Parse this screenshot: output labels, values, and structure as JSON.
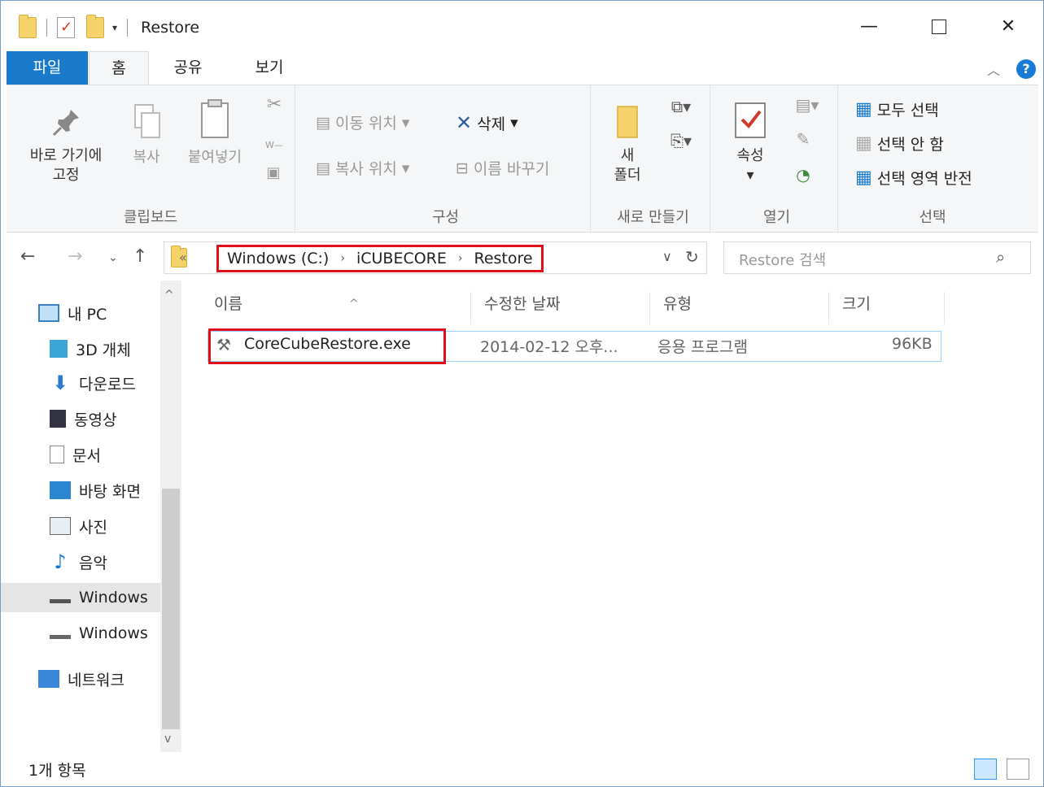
{
  "window": {
    "title": "Restore",
    "controls": {
      "minimize": "—",
      "close": "✕"
    }
  },
  "ribbon_tabs": [
    "파일",
    "홈",
    "공유",
    "보기"
  ],
  "ribbon": {
    "clipboard": {
      "label": "클립보드",
      "pin": "바로 가기에 고정",
      "pin_line1": "바로 가기에",
      "pin_line2": "고정",
      "copy": "복사",
      "paste": "붙여넣기"
    },
    "organize": {
      "label": "구성",
      "move_to": "이동 위치",
      "copy_to": "복사 위치",
      "delete": "삭제",
      "rename": "이름 바꾸기"
    },
    "new": {
      "label": "새로 만들기",
      "new_folder_line1": "새",
      "new_folder_line2": "폴더"
    },
    "open": {
      "label": "열기",
      "properties": "속성"
    },
    "select": {
      "label": "선택",
      "select_all": "모두 선택",
      "select_none": "선택 안 함",
      "invert": "선택 영역 반전"
    }
  },
  "address": {
    "overflow": "«",
    "crumbs": [
      "Windows (C:)",
      "iCUBECORE",
      "Restore"
    ],
    "search_placeholder": "Restore 검색"
  },
  "nav_pane": [
    {
      "label": "내 PC",
      "icon": "monitor-icon"
    },
    {
      "label": "3D 개체",
      "icon": "cube-icon"
    },
    {
      "label": "다운로드",
      "icon": "download-arrow-icon"
    },
    {
      "label": "동영상",
      "icon": "film-icon"
    },
    {
      "label": "문서",
      "icon": "document-icon"
    },
    {
      "label": "바탕 화면",
      "icon": "desktop-icon"
    },
    {
      "label": "사진",
      "icon": "picture-icon"
    },
    {
      "label": "음악",
      "icon": "music-note-icon"
    },
    {
      "label": "Windows",
      "icon": "drive-icon"
    },
    {
      "label": "Windows",
      "icon": "drive-icon"
    },
    {
      "label": "네트워크",
      "icon": "network-icon"
    }
  ],
  "columns": [
    "이름",
    "수정한 날짜",
    "유형",
    "크기"
  ],
  "files": [
    {
      "name": "CoreCubeRestore.exe",
      "modified": "2014-02-12 오후...",
      "type": "응용 프로그램",
      "size": "96KB"
    }
  ],
  "status": {
    "item_count": "1개 항목"
  },
  "colors": {
    "accent": "#1979ca",
    "highlight": "#e0101a",
    "selection_border": "#99d1ff"
  }
}
